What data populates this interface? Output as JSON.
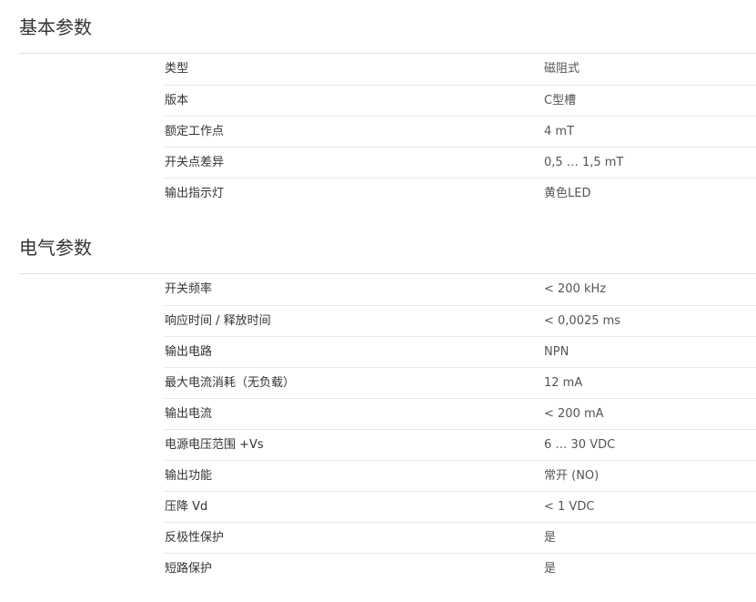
{
  "sections": [
    {
      "title": "基本参数",
      "rows": [
        {
          "label": "类型",
          "value": "磁阻式"
        },
        {
          "label": "版本",
          "value": "C型槽"
        },
        {
          "label": "额定工作点",
          "value": "4 mT"
        },
        {
          "label": "开关点差异",
          "value": "0,5 … 1,5 mT"
        },
        {
          "label": "输出指示灯",
          "value": "黄色LED"
        }
      ]
    },
    {
      "title": "电气参数",
      "rows": [
        {
          "label": "开关频率",
          "value": "< 200 kHz"
        },
        {
          "label": "响应时间 / 释放时间",
          "value": "< 0,0025 ms"
        },
        {
          "label": "输出电路",
          "value": "NPN"
        },
        {
          "label": "最大电流消耗（无负载）",
          "value": "12 mA"
        },
        {
          "label": "输出电流",
          "value": "< 200 mA"
        },
        {
          "label": "电源电压范围 +Vs",
          "value": "6 … 30 VDC"
        },
        {
          "label": "输出功能",
          "value": "常开 (NO)"
        },
        {
          "label": "压降 Vd",
          "value": "< 1 VDC"
        },
        {
          "label": "反极性保护",
          "value": "是"
        },
        {
          "label": "短路保护",
          "value": "是"
        }
      ]
    }
  ]
}
